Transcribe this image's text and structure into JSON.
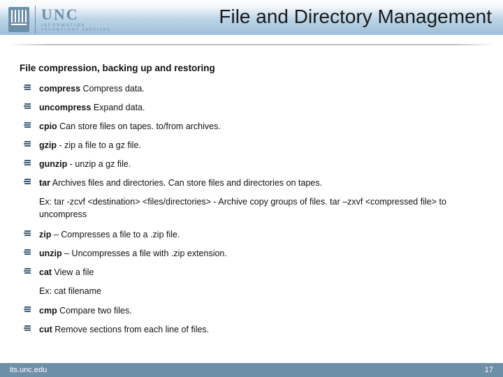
{
  "logo": {
    "unc": "UNC",
    "sub1": "INFORMATION",
    "sub2": "TECHNOLOGY SERVICES"
  },
  "title": "File and Directory Management",
  "section_title": "File compression, backing up and restoring",
  "items": [
    {
      "cmd": "compress",
      "desc": " Compress data."
    },
    {
      "cmd": "uncompress",
      "desc": " Expand data."
    },
    {
      "cmd": "cpio",
      "desc": " Can store files on tapes. to/from archives."
    },
    {
      "cmd": "gzip",
      "desc": " - zip a file to a gz file."
    },
    {
      "cmd": "gunzip",
      "desc": " - unzip a gz file."
    },
    {
      "cmd": "tar",
      "desc": " Archives files and directories. Can store files and directories on tapes."
    }
  ],
  "example1": "Ex: tar -zcvf <destination> <files/directories> - Archive copy groups of files. tar –zxvf <compressed file> to uncompress",
  "items2": [
    {
      "cmd": "zip",
      "desc": " – Compresses a file to a .zip file."
    },
    {
      "cmd": "unzip",
      "desc": " – Uncompresses a file with .zip extension."
    },
    {
      "cmd": "cat",
      "desc": " View a file"
    }
  ],
  "example2": "Ex: cat filename",
  "items3": [
    {
      "cmd": "cmp",
      "desc": " Compare two files."
    },
    {
      "cmd": "cut",
      "desc": " Remove sections from each line of files."
    }
  ],
  "footer": {
    "left": "its.unc.edu",
    "right": "17"
  }
}
